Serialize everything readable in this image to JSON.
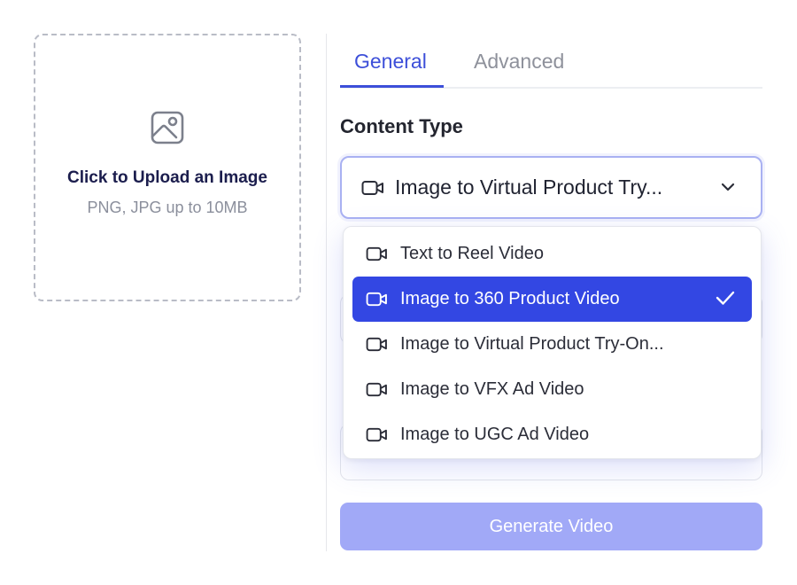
{
  "upload": {
    "title": "Click to Upload an Image",
    "hint": "PNG, JPG up to 10MB",
    "icon": "image-upload-icon"
  },
  "tabs": [
    {
      "label": "General",
      "active": true
    },
    {
      "label": "Advanced",
      "active": false
    }
  ],
  "content_type": {
    "label": "Content Type",
    "selected_display": "Image to Virtual Product Try...",
    "options": [
      {
        "label": "Text to Reel Video",
        "icon": "video-camera-icon",
        "selected": false
      },
      {
        "label": "Image to 360 Product Video",
        "icon": "video-camera-icon",
        "selected": true
      },
      {
        "label": "Image to Virtual Product Try-On...",
        "icon": "video-camera-icon",
        "selected": false
      },
      {
        "label": "Image to VFX Ad Video",
        "icon": "video-camera-icon",
        "selected": false
      },
      {
        "label": "Image to UGC Ad Video",
        "icon": "video-camera-icon",
        "selected": false
      }
    ]
  },
  "generate": {
    "label": "Generate Video"
  },
  "colors": {
    "accent": "#3D4FD9",
    "selected_item": "#3347E3",
    "button_disabled": "#A1A9F7"
  }
}
